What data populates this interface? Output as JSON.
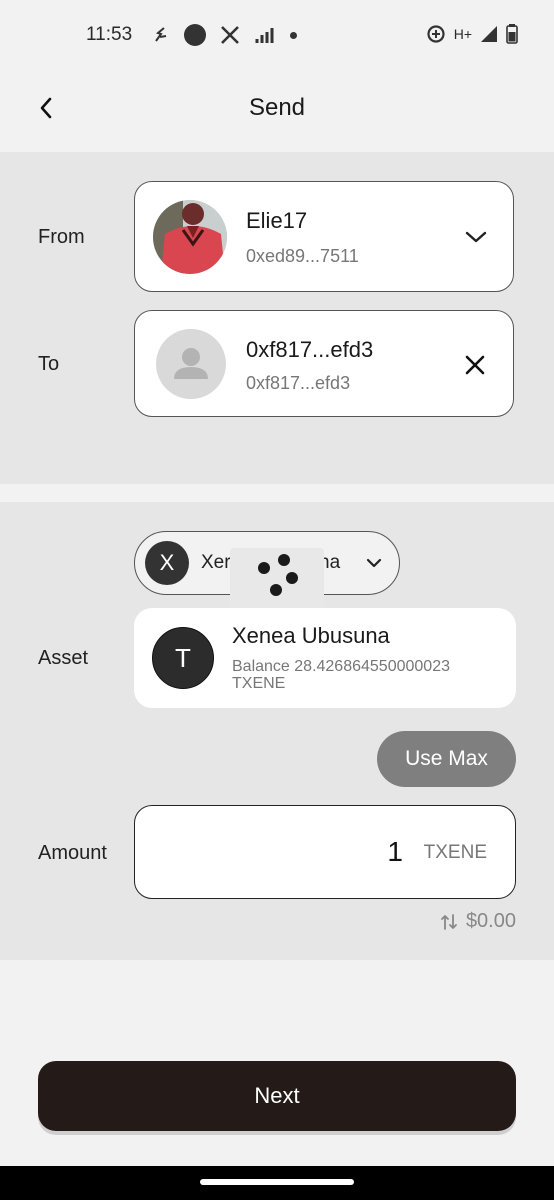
{
  "status": {
    "time": "11:53",
    "network": "H+"
  },
  "header": {
    "title": "Send"
  },
  "from": {
    "label": "From",
    "account_name": "Elie17",
    "account_address": "0xed89...7511"
  },
  "to": {
    "label": "To",
    "name": "0xf817...efd3",
    "address": "0xf817...efd3"
  },
  "asset_selector": {
    "icon_letter": "X",
    "label_visible": "Xer",
    "label_tail": "na"
  },
  "asset": {
    "label": "Asset",
    "icon_letter": "T",
    "name": "Xenea Ubusuna",
    "balance": "Balance 28.426864550000023 TXENE"
  },
  "use_max_label": "Use Max",
  "amount": {
    "label": "Amount",
    "value": "1",
    "unit": "TXENE",
    "fiat": "$0.00"
  },
  "next_label": "Next",
  "colors": {
    "primary_button": "#241a18",
    "secondary_button": "#7f7f7f"
  }
}
